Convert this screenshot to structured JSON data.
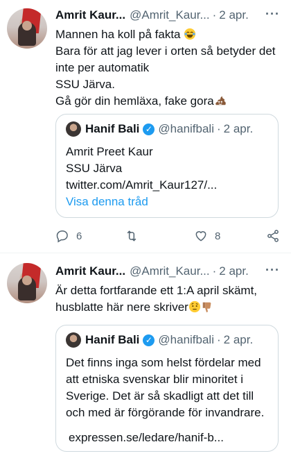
{
  "tweets": [
    {
      "author_name": "Amrit Kaur...",
      "handle": "@Amrit_Kaur...",
      "separator": "·",
      "date": "2 apr.",
      "more_icon": "more-dots-icon",
      "text_lines": [
        "Mannen ha koll på fakta",
        "Bara för att jag lever i orten så betyder det",
        "inte  per automatik",
        "SSU Järva.",
        "Gå gör din hemläxa, fake gora"
      ],
      "emojis": [
        "laughing-emoji",
        "poop-emoji"
      ],
      "quote": {
        "author_name": "Hanif Bali",
        "handle": "@hanifbali",
        "separator": "·",
        "date": "2 apr.",
        "text_lines": [
          "Amrit Preet Kaur",
          "SSU Järva",
          "twitter.com/Amrit_Kaur127/..."
        ],
        "link_text": "Visa denna tråd"
      },
      "actions": {
        "reply_count": "6",
        "retweet_count": "",
        "like_count": "8"
      }
    },
    {
      "author_name": "Amrit Kaur...",
      "handle": "@Amrit_Kaur...",
      "separator": "·",
      "date": "2 apr.",
      "more_icon": "more-dots-icon",
      "text_lines": [
        "Är detta fortfarande ett 1:A april skämt,",
        "husblatte här nere skriver"
      ],
      "emojis": [
        "raised-eyebrow-emoji",
        "thumbs-down-emoji"
      ],
      "quote": {
        "author_name": "Hanif Bali",
        "handle": "@hanifbali",
        "separator": "·",
        "date": "2 apr.",
        "text_lines": [
          "Det finns inga som helst fördelar med",
          "att etniska svenskar blir minoritet i",
          "Sverige. Det är så skadligt att det till",
          "och med är förgörande för invandrare."
        ],
        "link_text": "expressen.se/ledare/hanif-b..."
      }
    }
  ],
  "colors": {
    "text": "#0f1419",
    "secondary": "#536471",
    "accent": "#1d9bf0",
    "border": "#cfd9de"
  }
}
